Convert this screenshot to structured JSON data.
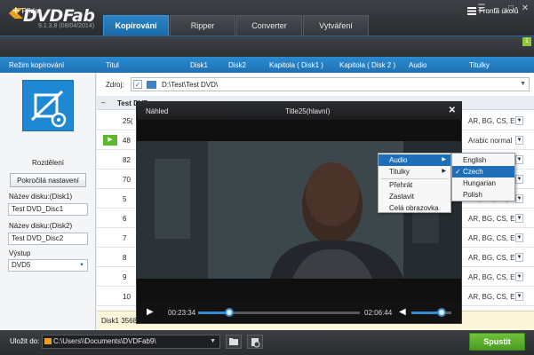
{
  "app": {
    "name": "DVDFab",
    "version": "9.1.3.8 (08/04/2014)"
  },
  "tabs": [
    {
      "label": "Kopírování",
      "active": true
    },
    {
      "label": "Ripper",
      "active": false
    },
    {
      "label": "Converter",
      "active": false
    },
    {
      "label": "Vytváření",
      "active": false
    }
  ],
  "window_controls": {
    "settings": "☰",
    "minimize": "–",
    "maximize": "□",
    "close": "✕"
  },
  "toolbar": {
    "add_label": "Přidat",
    "queue_label": "Fronta úkolů",
    "queue_count": "1"
  },
  "columns": {
    "mode": "Režim kopírování",
    "title": "Titul",
    "disc1": "Disk1",
    "disc2": "Disk2",
    "chapter1": "Kapitola ( Disk1 )",
    "chapter2": "Kapitola ( Disk 2 )",
    "audio": "Audio",
    "subtitles": "Titulky"
  },
  "left": {
    "mode_label": "Rozdělení",
    "advanced_button": "Pokročilá nastavení",
    "disc1_label": "Název disku:(Disk1)",
    "disc1_value": "Test DVD_Disc1",
    "disc2_label": "Název disku:(Disk2)",
    "disc2_value": "Test DVD_Disc2",
    "output_label": "Výstup",
    "output_value": "DVD5"
  },
  "source": {
    "label": "Zdroj:",
    "path": "D:\\Test\\Test DVD\\"
  },
  "group_label": "Test DVD",
  "rows": [
    {
      "num": "25(",
      "subs": "AR, BG, CS, E..."
    },
    {
      "num": "48",
      "subs": "Arabic normal",
      "playing": true
    },
    {
      "num": "82",
      "subs": "AR, BG, CS, E..."
    },
    {
      "num": "70",
      "subs": "AR, BG, CS, E..."
    },
    {
      "num": "5",
      "subs": "AR, BG, CS, E..."
    },
    {
      "num": "6",
      "subs": "AR, BG, CS, E..."
    },
    {
      "num": "7",
      "subs": "AR, BG, CS, E..."
    },
    {
      "num": "8",
      "subs": "AR, BG, CS, E..."
    },
    {
      "num": "9",
      "subs": "AR, BG, CS, E..."
    },
    {
      "num": "10",
      "subs": "AR, BG, CS, E..."
    }
  ],
  "info": {
    "text": "Disk1 3568"
  },
  "preview": {
    "window_title": "Náhled",
    "title": "Title25(hlavní)",
    "time_current": "00:23:34",
    "time_total": "02:06:44",
    "progress": 0.19,
    "volume": 0.75
  },
  "context_menu": {
    "items": [
      {
        "label": "Audio",
        "submenu": true,
        "highlighted": true
      },
      {
        "label": "Titulky",
        "submenu": true,
        "highlighted": false
      },
      {
        "label": "Přehrát",
        "submenu": false,
        "highlighted": false
      },
      {
        "label": "Zastavit",
        "submenu": false,
        "highlighted": false
      },
      {
        "label": "Celá obrazovka",
        "submenu": false,
        "highlighted": false
      }
    ]
  },
  "audio_submenu": {
    "items": [
      {
        "label": "English",
        "checked": false,
        "highlighted": false
      },
      {
        "label": "Czech",
        "checked": true,
        "highlighted": true
      },
      {
        "label": "Hungarian",
        "checked": false,
        "highlighted": false
      },
      {
        "label": "Polish",
        "checked": false,
        "highlighted": false
      }
    ]
  },
  "bottom": {
    "save_to_label": "Uložit do:",
    "path": "C:\\Users\\\\Documents\\DVDFab9\\",
    "start_button": "Spustit"
  },
  "colors": {
    "accent_blue": "#1f72b4",
    "start_green": "#4a9b22",
    "logo_orange": "#e6a21f"
  }
}
